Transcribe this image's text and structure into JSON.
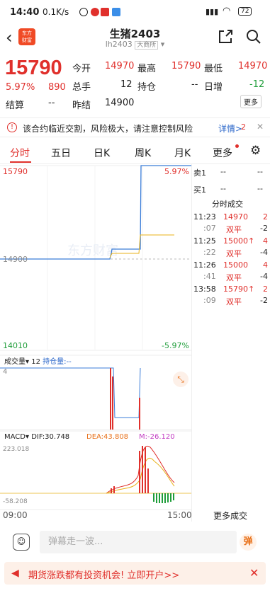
{
  "status_bar": {
    "time": "14:40",
    "network": "0.1K/s",
    "battery": "72"
  },
  "header": {
    "logo_text_1": "东方",
    "logo_text_2": "财富",
    "title": "生猪2403",
    "code": "lh2403",
    "exchange": "大商所"
  },
  "quote": {
    "last_price": "15790",
    "change_pct": "5.97%",
    "change": "890",
    "settle_label": "结算",
    "settle_value": "--",
    "open_label": "今开",
    "open_value": "14970",
    "high_label": "最高",
    "high_value": "15790",
    "low_label": "最低",
    "low_value": "14970",
    "volume_label": "总手",
    "volume_value": "12",
    "oi_label": "持仓",
    "oi_value": "--",
    "daily_inc_label": "日增",
    "daily_inc_value": "-12",
    "prev_settle_label": "昨结",
    "prev_settle_value": "14900",
    "more_label": "更多"
  },
  "warning": {
    "text": "该合约临近交割，风险极大，请注意控制风险",
    "link": "详情>",
    "badge": "2"
  },
  "tabs": [
    "分时",
    "五日",
    "日K",
    "周K",
    "月K",
    "更多"
  ],
  "chart": {
    "price_top": "15790",
    "price_mid": "14900",
    "price_bottom": "14010",
    "pct_top": "5.97%",
    "pct_bottom": "-5.97%",
    "watermark": "东方财富",
    "vol_label": "成交量",
    "vol_value": "12",
    "oi_label": "持仓量:--",
    "vol_axis": "4",
    "macd_label": "MACD",
    "dif_label": "DIF:30.748",
    "dea_label": "DEA:43.808",
    "m_label": "M:-26.120",
    "macd_top": "223.018",
    "macd_bottom": "-58.208",
    "time_start": "09:00",
    "time_end": "15:00",
    "colors": {
      "price_line": "#3b7dd8",
      "avg_line": "#e8b21a",
      "up": "#e0302c",
      "down": "#1f9d3a"
    }
  },
  "order_book": {
    "sell1_label": "卖1",
    "sell1_price": "--",
    "sell1_vol": "--",
    "buy1_label": "买1",
    "buy1_price": "--",
    "buy1_vol": "--"
  },
  "trades": {
    "title": "分时成交",
    "rows": [
      {
        "time": "11:23",
        "price": "14970",
        "vol": "2",
        "sub": ":07",
        "type": "双平",
        "delta": "-2"
      },
      {
        "time": "11:25",
        "price": "15000↑",
        "vol": "4",
        "sub": ":22",
        "type": "双平",
        "delta": "-4"
      },
      {
        "time": "11:26",
        "price": "15000",
        "vol": "4",
        "sub": ":41",
        "type": "双平",
        "delta": "-4"
      },
      {
        "time": "13:58",
        "price": "15790↑",
        "vol": "2",
        "sub": ":09",
        "type": "双平",
        "delta": "-2"
      }
    ],
    "more": "更多成交"
  },
  "comment": {
    "placeholder": "弹幕走一波...",
    "danmu_btn": "弹"
  },
  "banner": {
    "text": "期货涨跌都有投资机会! 立即开户>>"
  }
}
